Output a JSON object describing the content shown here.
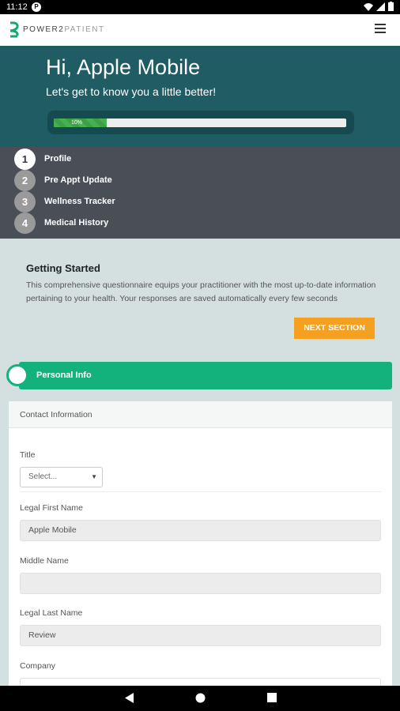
{
  "status": {
    "time": "11:12",
    "badge": "P"
  },
  "app": {
    "brand_strong": "POWER2",
    "brand_light": "PATIENT"
  },
  "hero": {
    "greeting": "Hi, Apple Mobile",
    "subtitle": "Let's get to know you a little better!",
    "progress_label": "10%",
    "progress_fraction": 0.18
  },
  "steps": [
    {
      "num": "1",
      "label": "Profile"
    },
    {
      "num": "2",
      "label": "Pre Appt Update"
    },
    {
      "num": "3",
      "label": "Wellness Tracker"
    },
    {
      "num": "4",
      "label": "Medical History"
    }
  ],
  "intro": {
    "title": "Getting Started",
    "body": "This comprehensive questionnaire equips your practitioner with the most up-to-date information pertaining to your health. Your responses are saved automatically every few seconds",
    "next_label": "NEXT SECTION"
  },
  "section": {
    "label": "Personal Info"
  },
  "form": {
    "header": "Contact Information",
    "title_label": "Title",
    "title_value": "Select...",
    "first_label": "Legal First Name",
    "first_value": "Apple Mobile",
    "middle_label": "Middle Name",
    "middle_value": "",
    "last_label": "Legal Last Name",
    "last_value": "Review",
    "company_label": "Company"
  },
  "colors": {
    "hero": "#1f5c63",
    "steps": "#4a4e57",
    "accent_green": "#13b27c",
    "button_orange": "#f5a020",
    "progress_green": "#45b24f"
  }
}
